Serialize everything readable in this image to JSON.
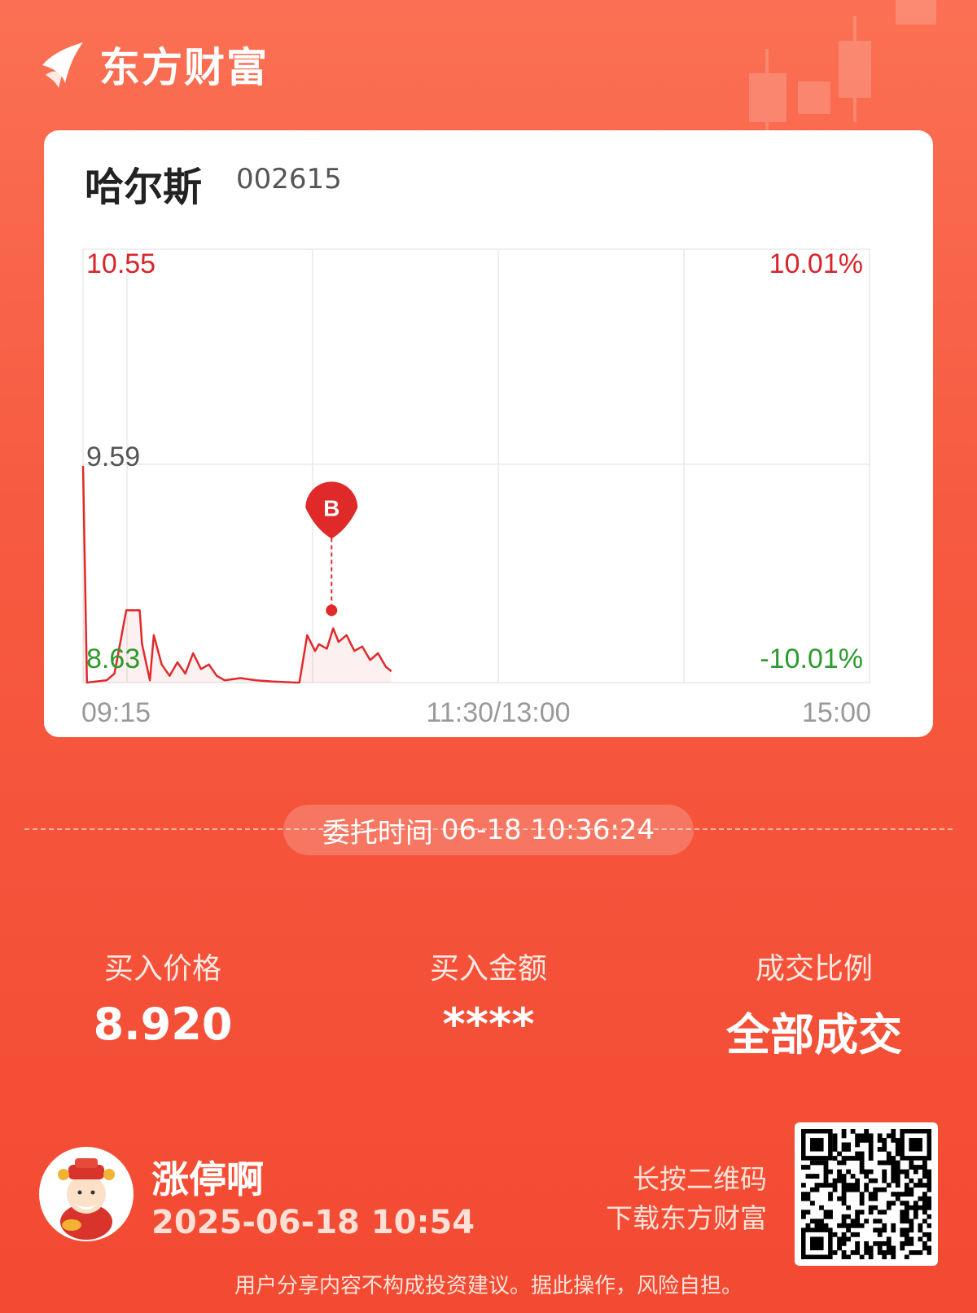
{
  "app": {
    "name": "东方财富"
  },
  "stock": {
    "name": "哈尔斯",
    "code": "002615"
  },
  "chart": {
    "price_top_label": "10.55",
    "price_mid_label": "9.59",
    "price_bottom_label": "8.63",
    "pct_top_label": "10.01%",
    "pct_bottom_label": "-10.01%",
    "time_start_label": "09:15",
    "time_mid_label": "11:30/13:00",
    "time_end_label": "15:00",
    "marker_label": "B",
    "colors": {
      "line": "#e02a2a",
      "up": "#d8242b",
      "down": "#2c9a2c",
      "grid": "#e8e8e8"
    }
  },
  "chart_data": {
    "type": "line",
    "ylim": [
      8.63,
      10.55
    ],
    "y_mid": 9.59,
    "pct_range": [
      "-10.01%",
      "10.01%"
    ],
    "x_ticks": [
      "09:15",
      "11:30/13:00",
      "15:00"
    ],
    "series": [
      {
        "values": [
          [
            0.0,
            9.59
          ],
          [
            0.005,
            8.63
          ],
          [
            0.03,
            8.64
          ],
          [
            0.04,
            8.67
          ],
          [
            0.055,
            8.95
          ],
          [
            0.072,
            8.95
          ],
          [
            0.075,
            8.8
          ],
          [
            0.08,
            8.72
          ],
          [
            0.085,
            8.64
          ],
          [
            0.09,
            8.84
          ],
          [
            0.1,
            8.71
          ],
          [
            0.11,
            8.66
          ],
          [
            0.12,
            8.72
          ],
          [
            0.13,
            8.67
          ],
          [
            0.14,
            8.76
          ],
          [
            0.15,
            8.69
          ],
          [
            0.16,
            8.71
          ],
          [
            0.17,
            8.66
          ],
          [
            0.18,
            8.64
          ],
          [
            0.2,
            8.65
          ],
          [
            0.22,
            8.64
          ],
          [
            0.24,
            8.635
          ],
          [
            0.27,
            8.63
          ],
          [
            0.275,
            8.63
          ],
          [
            0.285,
            8.84
          ],
          [
            0.295,
            8.77
          ],
          [
            0.3,
            8.8
          ],
          [
            0.31,
            8.78
          ],
          [
            0.318,
            8.87
          ],
          [
            0.325,
            8.81
          ],
          [
            0.335,
            8.84
          ],
          [
            0.345,
            8.77
          ],
          [
            0.355,
            8.79
          ],
          [
            0.365,
            8.73
          ],
          [
            0.375,
            8.76
          ],
          [
            0.385,
            8.7
          ],
          [
            0.392,
            8.68
          ]
        ]
      }
    ],
    "markers": [
      {
        "label": "B",
        "x_frac": 0.316,
        "y": 8.95,
        "note": "buy"
      }
    ]
  },
  "order": {
    "time_label": "委托时间",
    "time_value": "06-18 10:36:24"
  },
  "stats": {
    "buy_price_label": "买入价格",
    "buy_price_value": "8.920",
    "buy_amount_label": "买入金额",
    "buy_amount_value": "****",
    "fill_ratio_label": "成交比例",
    "fill_ratio_value": "全部成交"
  },
  "user": {
    "name": "涨停啊",
    "date": "2025-06-18 10:54"
  },
  "qr": {
    "hint_line1": "长按二维码",
    "hint_line2": "下载东方财富"
  },
  "footer": {
    "disclaimer": "用户分享内容不构成投资建议。据此操作，风险自担。"
  }
}
